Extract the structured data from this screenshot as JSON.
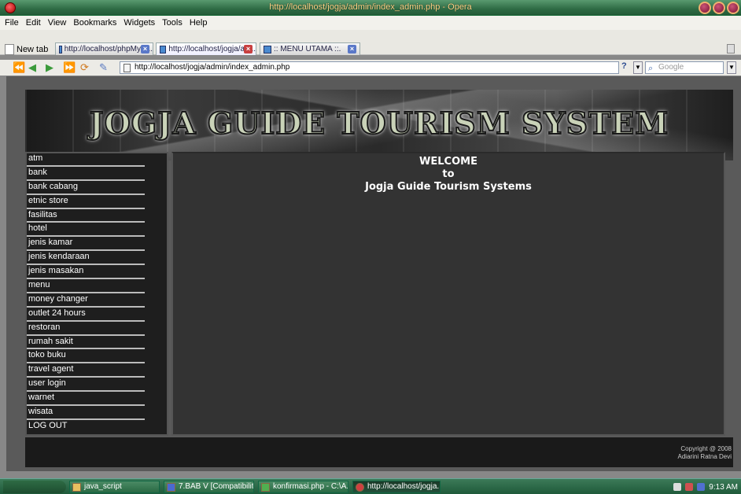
{
  "window": {
    "title": "http://localhost/jogja/admin/index_admin.php - Opera"
  },
  "menubar": [
    "File",
    "Edit",
    "View",
    "Bookmarks",
    "Widgets",
    "Tools",
    "Help"
  ],
  "tabs": {
    "new_tab_label": "New tab",
    "items": [
      {
        "label": "http://localhost/phpMyA..."
      },
      {
        "label": "http://localhost/jogja/ad..."
      },
      {
        "label": ":: MENU UTAMA ::."
      }
    ]
  },
  "address_bar": {
    "url": "http://localhost/jogja/admin/index_admin.php"
  },
  "search": {
    "placeholder": "Google"
  },
  "page": {
    "banner_title": "JOGJA GUIDE TOURISM SYSTEM",
    "menu": [
      "atm",
      "bank",
      "bank cabang",
      "etnic store",
      "fasilitas",
      "hotel",
      "jenis kamar",
      "jenis kendaraan",
      "jenis masakan",
      "menu",
      "money changer",
      "outlet 24 hours",
      "restoran",
      "rumah sakit",
      "toko buku",
      "travel agent",
      "user login",
      "warnet",
      "wisata",
      "LOG OUT"
    ],
    "welcome": {
      "line1": "WELCOME",
      "line2": "to",
      "line3": "Jogja Guide Tourism Systems"
    },
    "footer": {
      "copyright": "Copyright @ 2008",
      "author": "Adiarini Ratna Devi"
    }
  },
  "taskbar": {
    "items": [
      "java_script",
      "7.BAB V [Compatibilit...",
      "konfirmasi.php - C:\\A...",
      "http://localhost/jogja..."
    ],
    "clock": "9:13 AM"
  }
}
